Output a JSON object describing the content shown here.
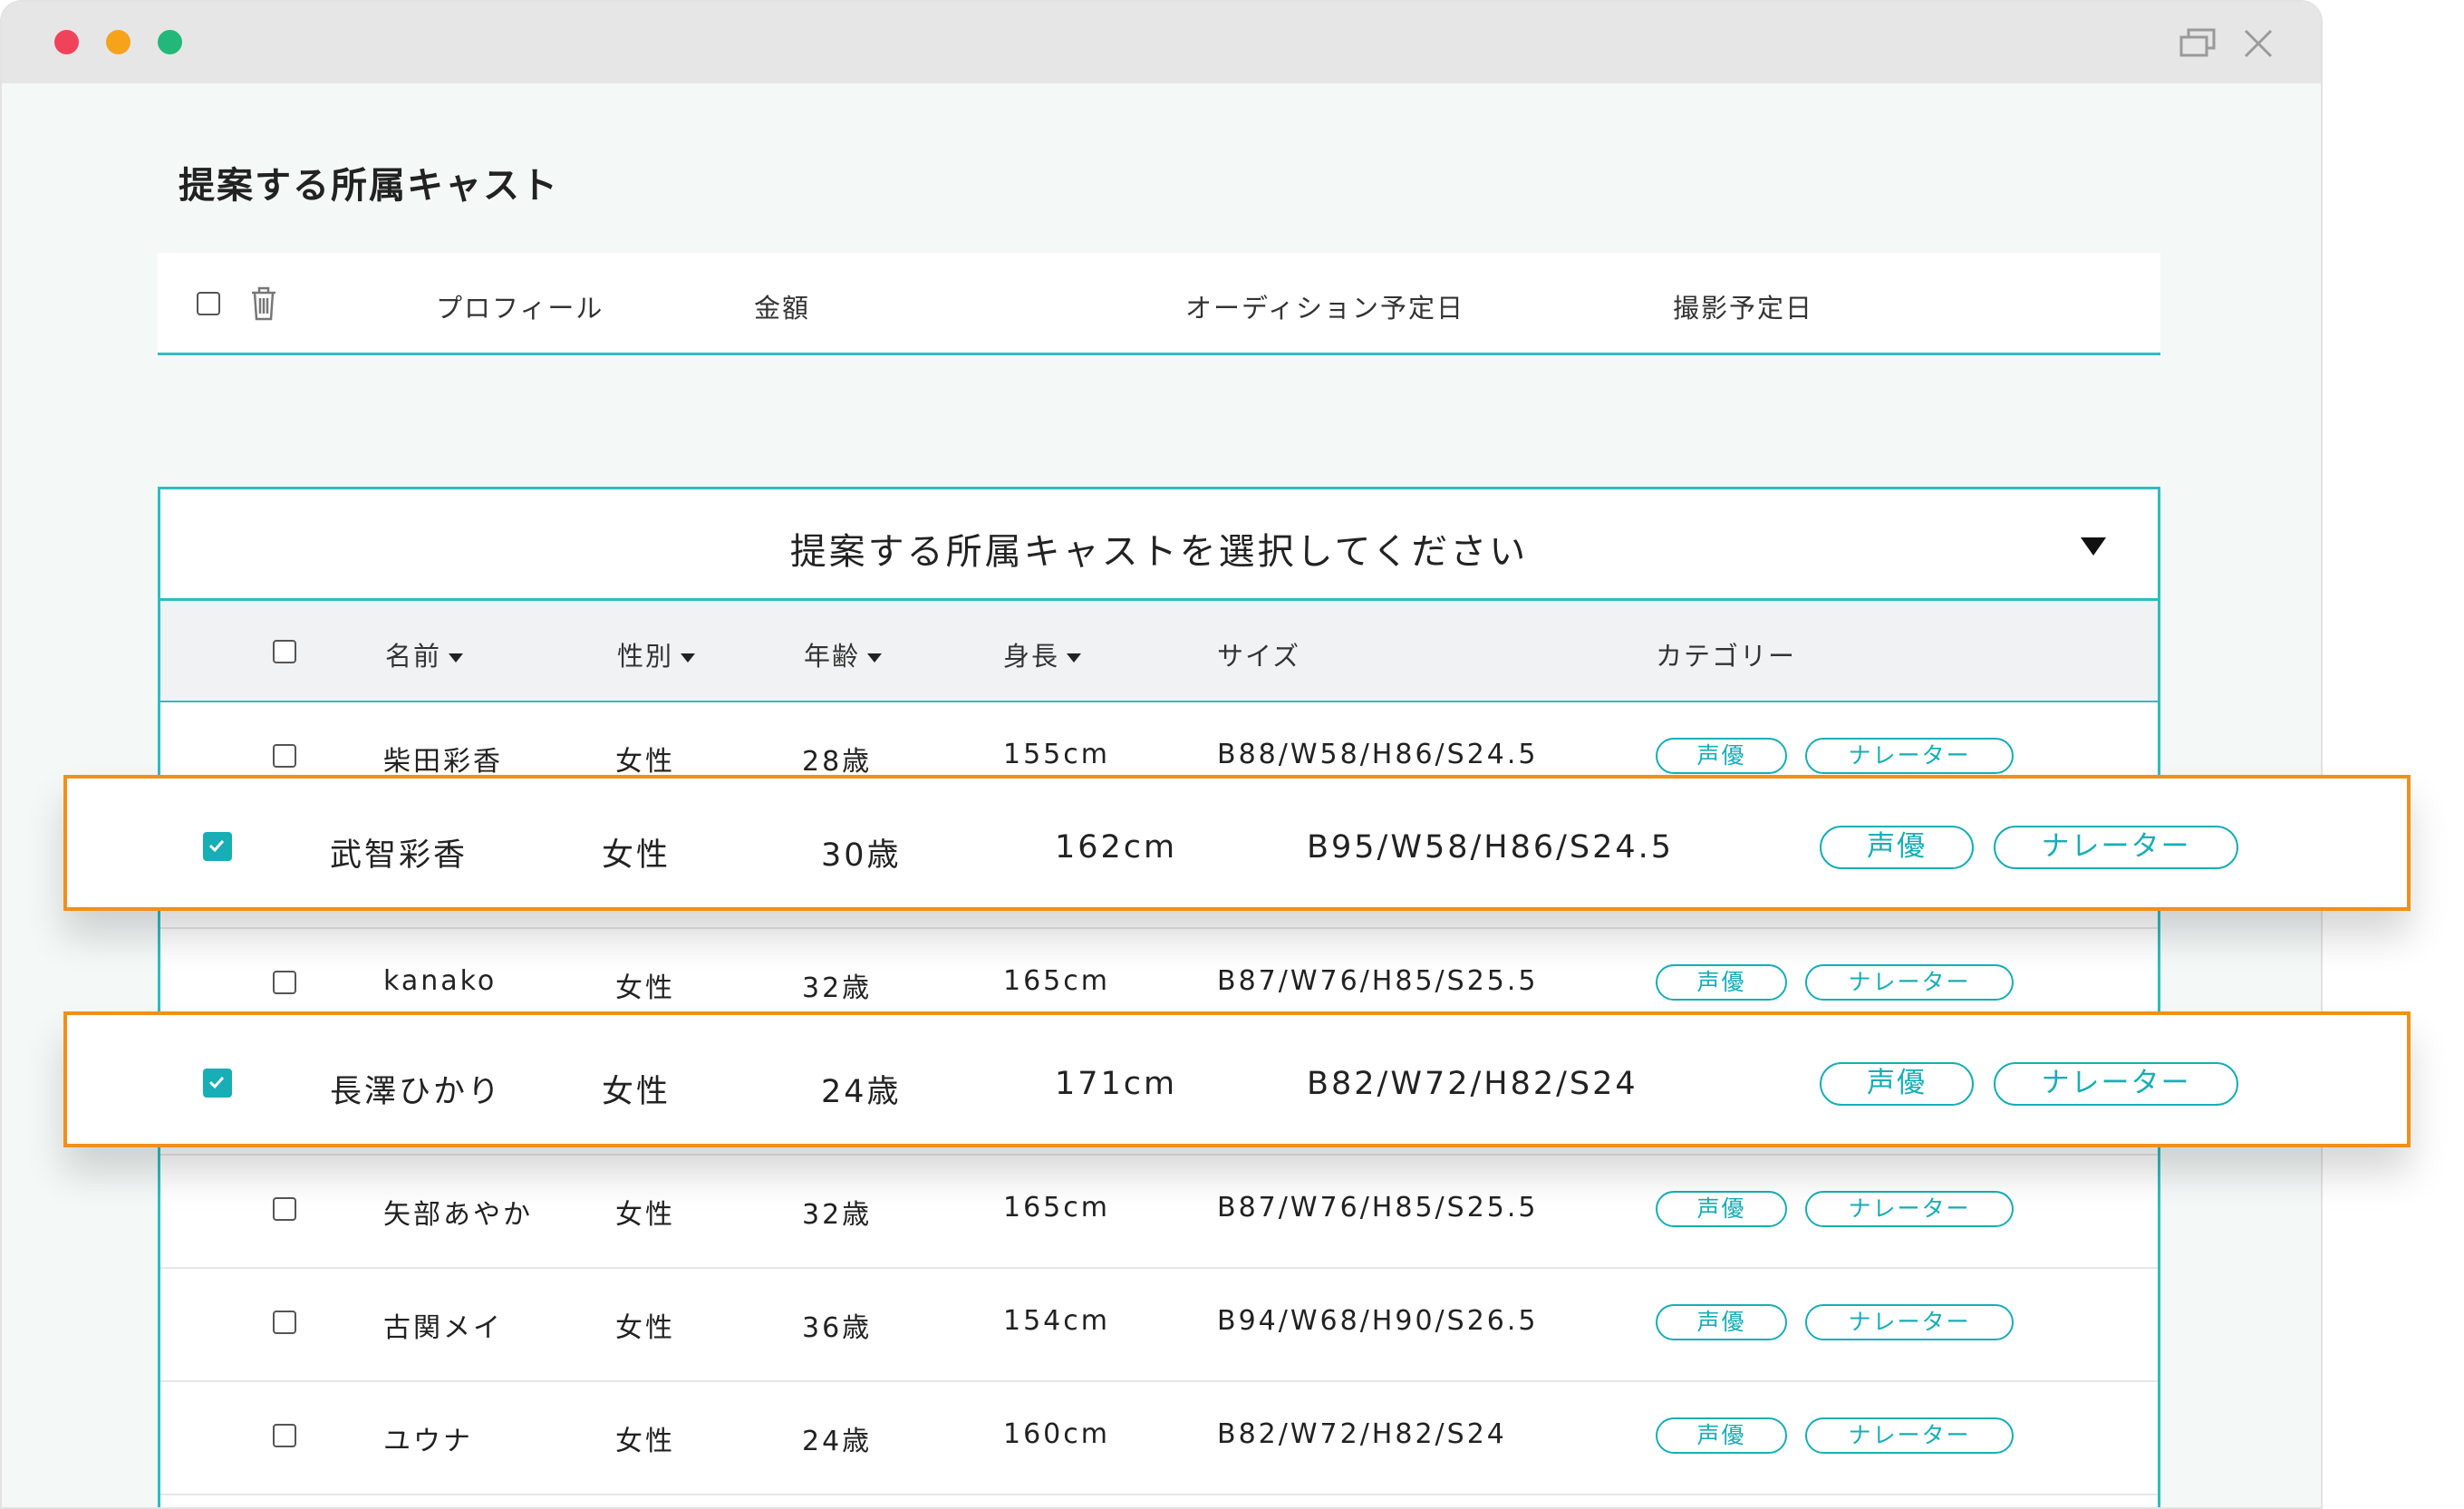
{
  "page": {
    "title": "提案する所属キャスト"
  },
  "proposal_table": {
    "columns": [
      "プロフィール",
      "金額",
      "オーディション予定日",
      "撮影予定日"
    ]
  },
  "cast_selector": {
    "placeholder": "提案する所属キャストを選択してください",
    "columns": {
      "name": "名前",
      "gender": "性別",
      "age": "年齢",
      "height": "身長",
      "size": "サイズ",
      "category": "カテゴリー"
    },
    "rows": [
      {
        "name": "柴田彩香",
        "gender": "女性",
        "age": "28歳",
        "height": "155cm",
        "size": "B88/W58/H86/S24.5",
        "tags": [
          "声優",
          "ナレーター"
        ],
        "checked": false
      },
      {
        "name": "武智彩香",
        "gender": "女性",
        "age": "30歳",
        "height": "162cm",
        "size": "B95/W58/H86/S24.5",
        "tags": [
          "声優",
          "ナレーター"
        ],
        "checked": true
      },
      {
        "name": "kanako",
        "gender": "女性",
        "age": "32歳",
        "height": "165cm",
        "size": "B87/W76/H85/S25.5",
        "tags": [
          "声優",
          "ナレーター"
        ],
        "checked": false
      },
      {
        "name": "長澤ひかり",
        "gender": "女性",
        "age": "24歳",
        "height": "171cm",
        "size": "B82/W72/H82/S24",
        "tags": [
          "声優",
          "ナレーター"
        ],
        "checked": true
      },
      {
        "name": "矢部あやか",
        "gender": "女性",
        "age": "32歳",
        "height": "165cm",
        "size": "B87/W76/H85/S25.5",
        "tags": [
          "声優",
          "ナレーター"
        ],
        "checked": false
      },
      {
        "name": "古関メイ",
        "gender": "女性",
        "age": "36歳",
        "height": "154cm",
        "size": "B94/W68/H90/S26.5",
        "tags": [
          "声優",
          "ナレーター"
        ],
        "checked": false
      },
      {
        "name": "ユウナ",
        "gender": "女性",
        "age": "24歳",
        "height": "160cm",
        "size": "B82/W72/H82/S24",
        "tags": [
          "声優",
          "ナレーター"
        ],
        "checked": false
      }
    ]
  },
  "colors": {
    "accent": "#17aeb5",
    "highlight": "#f28f1a"
  }
}
